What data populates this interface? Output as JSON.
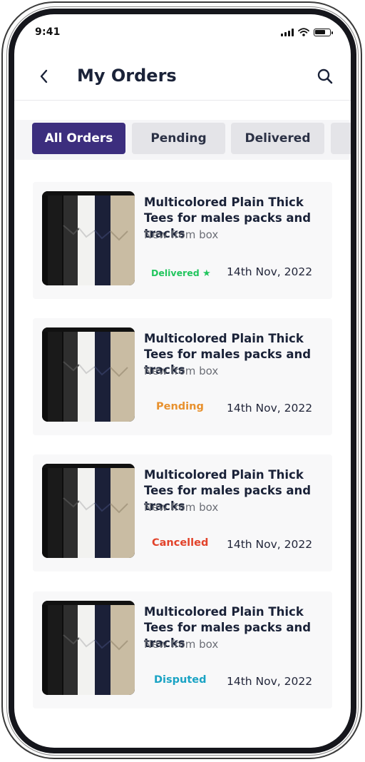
{
  "status_bar": {
    "time": "9:41"
  },
  "header": {
    "title": "My Orders"
  },
  "tabs": [
    {
      "label": "All Orders",
      "active": true
    },
    {
      "label": "Pending",
      "active": false
    },
    {
      "label": "Delivered",
      "active": false
    }
  ],
  "orders": [
    {
      "title": "Multicolored Plain Thick Tees for males packs and tracks",
      "subtitle": "New from box",
      "status": "Delivered",
      "status_color": "#22c55e",
      "date": "14th Nov, 2022"
    },
    {
      "title": "Multicolored Plain Thick Tees for males packs and tracks",
      "subtitle": "New from box",
      "status": "Pending",
      "status_color": "#e8912e",
      "date": "14th Nov, 2022"
    },
    {
      "title": "Multicolored Plain Thick Tees for males packs and tracks",
      "subtitle": "New from box",
      "status": "Cancelled",
      "status_color": "#e2422a",
      "date": "14th Nov, 2022"
    },
    {
      "title": "Multicolored Plain Thick Tees for males packs and tracks",
      "subtitle": "New from box",
      "status": "Disputed",
      "status_color": "#1aa3c4",
      "date": "14th Nov, 2022"
    }
  ],
  "colors": {
    "accent": "#3c2e7e",
    "title_text": "#1a2238"
  },
  "icons": [
    "back-arrow-icon",
    "search-icon",
    "signal-icon",
    "wifi-icon",
    "battery-icon",
    "star-icon"
  ]
}
